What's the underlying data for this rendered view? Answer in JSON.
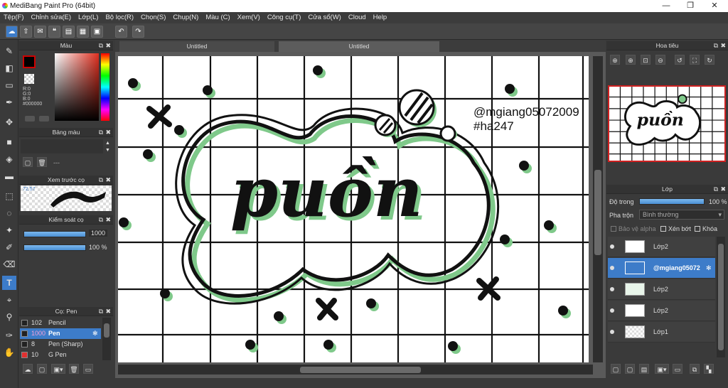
{
  "app": {
    "title": "MediBang Paint Pro (64bit)"
  },
  "window": {
    "minimize": "—",
    "maximize": "❐",
    "close": "✕"
  },
  "menu": [
    "Tệp(F)",
    "Chỉnh sửa(E)",
    "Lớp(L)",
    "Bộ lọc(R)",
    "Chọn(S)",
    "Chụp(N)",
    "Màu (C)",
    "Xem(V)",
    "Công cụ(T)",
    "Cửa sổ(W)",
    "Cloud",
    "Help"
  ],
  "color_panel": {
    "title": "Màu",
    "r": "R:0",
    "g": "G:0",
    "b": "B:0",
    "hex": "#000000",
    "fg": "#000000",
    "bg": "#ffffff"
  },
  "palette_panel": {
    "title": "Bảng màu",
    "value": "---"
  },
  "brush_preview": {
    "title": "Xem trước cọ",
    "size": "72.57"
  },
  "brush_control": {
    "title": "Kiểm soát cọ",
    "size": "1000",
    "opacity": "100 %"
  },
  "brush_panel": {
    "title": "Cọ: Pen",
    "items": [
      {
        "size": "102",
        "name": "Pencil",
        "swatch": "#222222"
      },
      {
        "size": "1000",
        "name": "Pen",
        "swatch": "#222222",
        "selected": true
      },
      {
        "size": "8",
        "name": "Pen (Sharp)",
        "swatch": "#222222"
      },
      {
        "size": "10",
        "name": "G Pen",
        "swatch": "#e03030"
      }
    ]
  },
  "tabs": [
    "Untitled",
    "Untitled"
  ],
  "canvas": {
    "text_main": "puồn",
    "text_handle": "@mgiang05072009",
    "text_tag": "#ha247"
  },
  "navigator": {
    "title": "Hoa tiêu"
  },
  "layer_panel": {
    "title": "Lớp",
    "opacity_label": "Độ trong",
    "opacity_value": "100 %",
    "blend_label": "Pha trộn",
    "blend_value": "Bình thường",
    "protect_alpha": "Bảo vệ alpha",
    "clipping": "Xén bớt",
    "lock": "Khóa",
    "layers": [
      {
        "name": "Lớp2"
      },
      {
        "name": "@mgiang05072",
        "selected": true
      },
      {
        "name": "Lớp2"
      },
      {
        "name": "Lớp2"
      },
      {
        "name": "Lớp1"
      }
    ]
  },
  "colors": {
    "accent": "#3d7cc9",
    "outline_green": "#7fc98a",
    "selection": "#3d7cc9"
  },
  "icons": [
    "brush-icon",
    "eraser-icon",
    "select-rect-icon",
    "pen-icon",
    "move-icon",
    "fill-rect-icon",
    "bucket-icon",
    "gradient-icon",
    "select-icon",
    "lasso-icon",
    "magic-wand-icon",
    "select-pen-icon",
    "select-eraser-icon",
    "text-icon",
    "operation-icon",
    "eyedropper-icon",
    "eyedropper2-icon",
    "hand-icon"
  ]
}
